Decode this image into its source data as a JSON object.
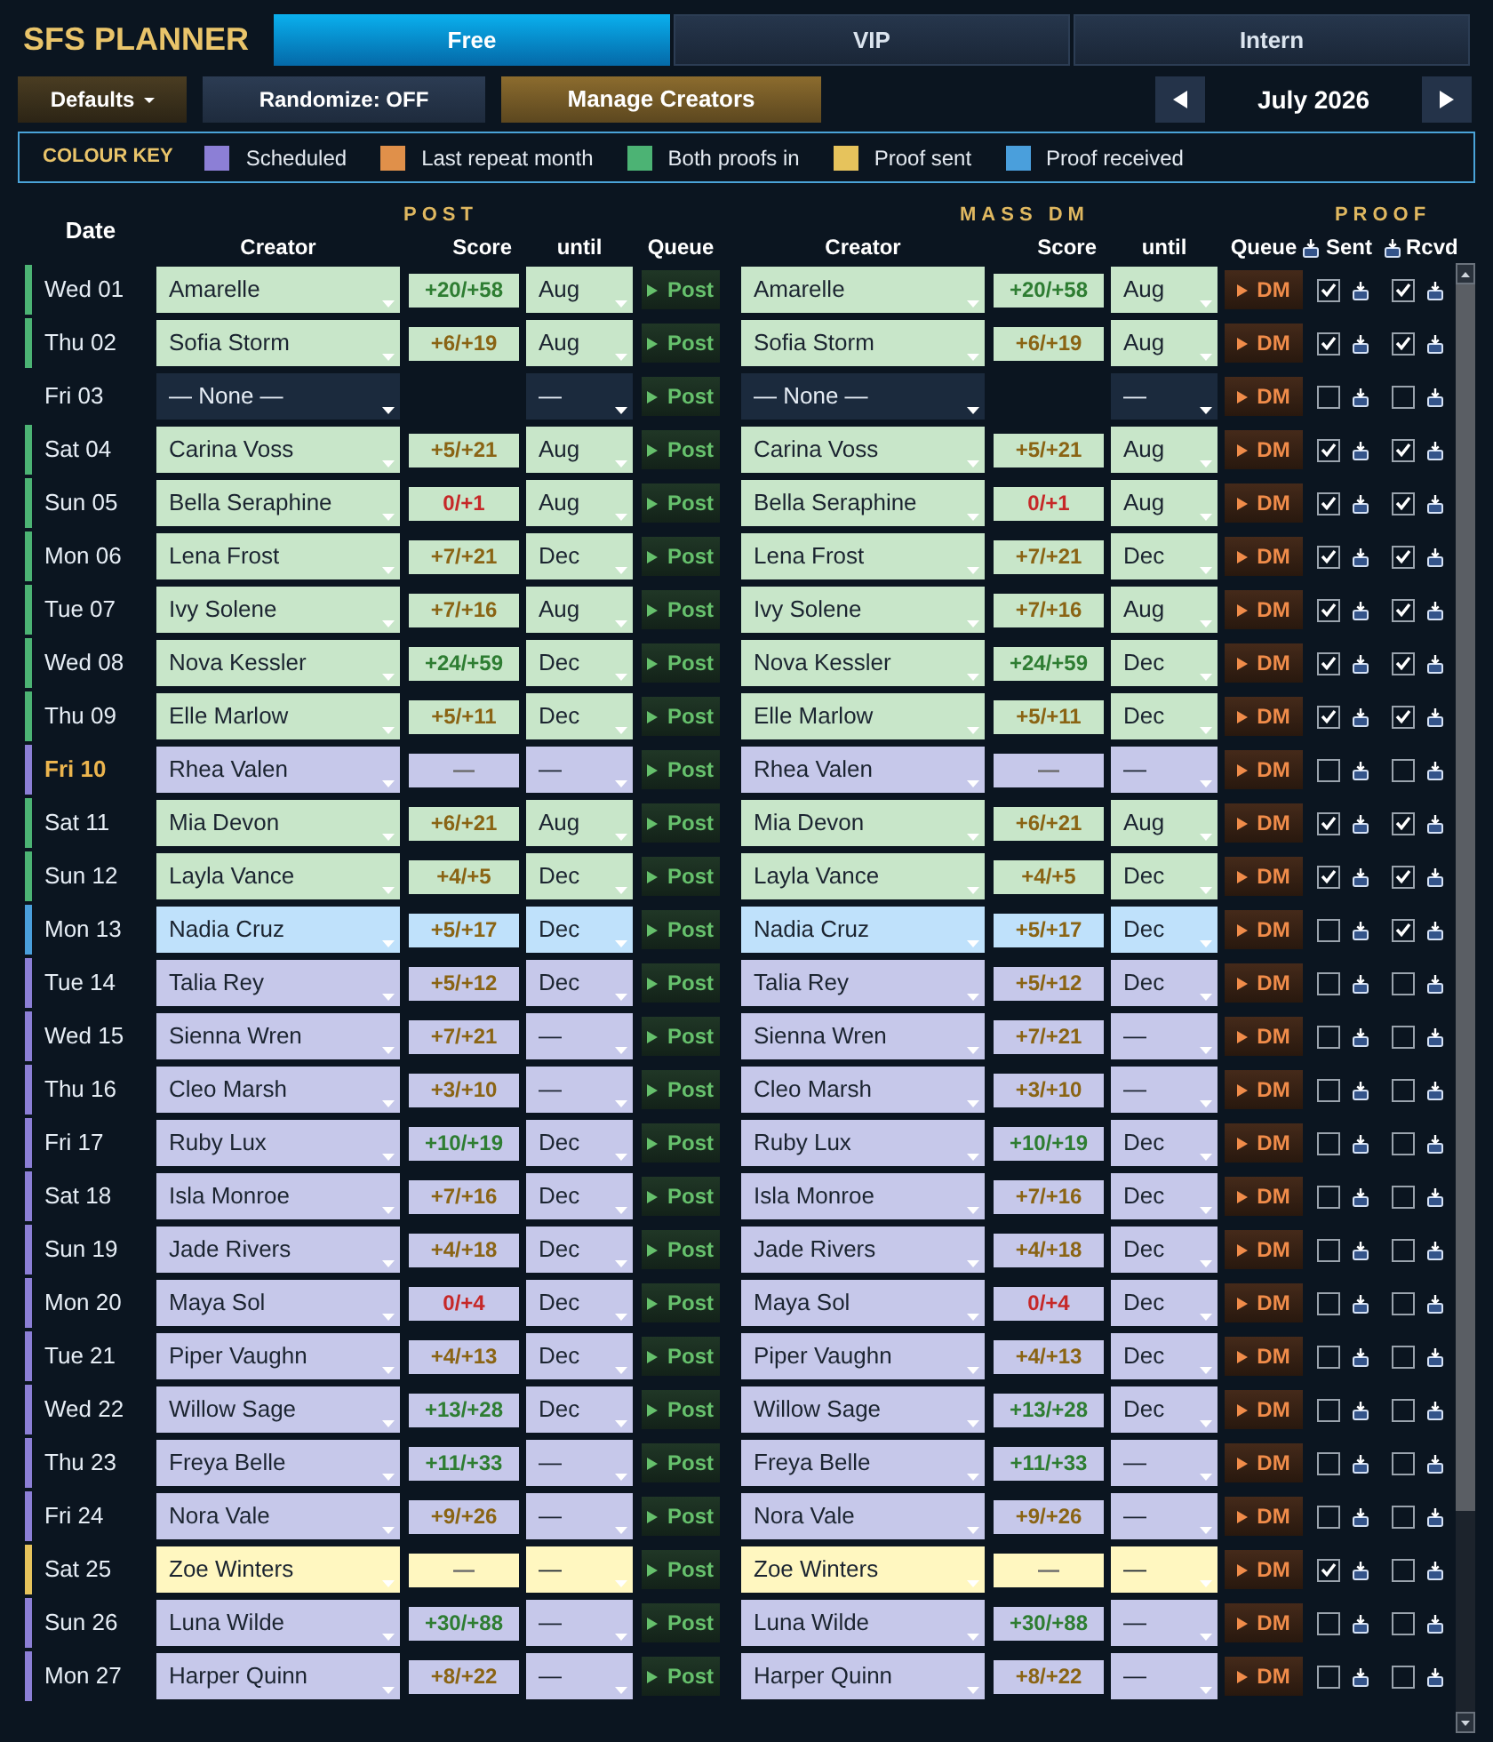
{
  "app": {
    "title": "SFS PLANNER"
  },
  "tabs": [
    {
      "label": "Free",
      "selected": true
    },
    {
      "label": "VIP",
      "selected": false
    },
    {
      "label": "Intern",
      "selected": false
    }
  ],
  "toolbar": {
    "defaults_button": "Defaults",
    "randomize_button": "Randomize: OFF",
    "manage_button": "Manage Creators",
    "month": "July 2026"
  },
  "colour_key": {
    "title": "COLOUR KEY",
    "items": [
      {
        "label": "Scheduled",
        "color": "#8c7fd6"
      },
      {
        "label": "Last repeat month",
        "color": "#e0904a"
      },
      {
        "label": "Both proofs in",
        "color": "#4cb374"
      },
      {
        "label": "Proof sent",
        "color": "#e6c35c"
      },
      {
        "label": "Proof received",
        "color": "#4a9fdc"
      }
    ]
  },
  "table": {
    "columns": {
      "date": "Date",
      "post": {
        "label": "POST",
        "creator": "Creator",
        "score": "Score",
        "until": "until",
        "queue": "Queue"
      },
      "mass_dm": {
        "label": "MASS DM",
        "creator": "Creator",
        "score": "Score",
        "until": "until",
        "queue": "Queue"
      },
      "proof": {
        "label": "PROOF",
        "sent": "Sent",
        "received": "Rcvd"
      }
    },
    "rows": [
      {
        "date": "Wed 01",
        "highlighted": false,
        "color": "#4cb374",
        "post": {
          "creator": "Amarelle",
          "score": {
            "value": "+20/+58",
            "color": "#2e7d32"
          },
          "until": "Aug",
          "queue_button": "Post"
        },
        "mass_dm": {
          "creator": "Amarelle",
          "score": {
            "value": "+20/+58",
            "color": "#2e7d32"
          },
          "until": "Aug",
          "queue_button": "DM"
        },
        "proof_sent": true,
        "proof_received": true
      },
      {
        "date": "Thu 02",
        "highlighted": false,
        "color": "#4cb374",
        "post": {
          "creator": "Sofia Storm",
          "score": {
            "value": "+6/+19",
            "color": "#8a6414"
          },
          "until": "Aug",
          "queue_button": "Post"
        },
        "mass_dm": {
          "creator": "Sofia Storm",
          "score": {
            "value": "+6/+19",
            "color": "#8a6414"
          },
          "until": "Aug",
          "queue_button": "DM"
        },
        "proof_sent": true,
        "proof_received": true
      },
      {
        "date": "Fri 03",
        "highlighted": false,
        "post": {
          "creator": "— None —",
          "until": "—",
          "queue_button": "Post"
        },
        "mass_dm": {
          "creator": "— None —",
          "until": "—",
          "queue_button": "DM"
        },
        "proof_sent": false,
        "proof_received": false
      },
      {
        "date": "Sat 04",
        "highlighted": false,
        "color": "#4cb374",
        "post": {
          "creator": "Carina Voss",
          "score": {
            "value": "+5/+21",
            "color": "#8a6414"
          },
          "until": "Aug",
          "queue_button": "Post"
        },
        "mass_dm": {
          "creator": "Carina Voss",
          "score": {
            "value": "+5/+21",
            "color": "#8a6414"
          },
          "until": "Aug",
          "queue_button": "DM"
        },
        "proof_sent": true,
        "proof_received": true
      },
      {
        "date": "Sun 05",
        "highlighted": false,
        "color": "#4cb374",
        "post": {
          "creator": "Bella Seraphine",
          "score": {
            "value": "0/+1",
            "color": "#c62828"
          },
          "until": "Aug",
          "queue_button": "Post"
        },
        "mass_dm": {
          "creator": "Bella Seraphine",
          "score": {
            "value": "0/+1",
            "color": "#c62828"
          },
          "until": "Aug",
          "queue_button": "DM"
        },
        "proof_sent": true,
        "proof_received": true
      },
      {
        "date": "Mon 06",
        "highlighted": false,
        "color": "#4cb374",
        "post": {
          "creator": "Lena Frost",
          "score": {
            "value": "+7/+21",
            "color": "#8a6414"
          },
          "until": "Dec",
          "queue_button": "Post"
        },
        "mass_dm": {
          "creator": "Lena Frost",
          "score": {
            "value": "+7/+21",
            "color": "#8a6414"
          },
          "until": "Dec",
          "queue_button": "DM"
        },
        "proof_sent": true,
        "proof_received": true
      },
      {
        "date": "Tue 07",
        "highlighted": false,
        "color": "#4cb374",
        "post": {
          "creator": "Ivy Solene",
          "score": {
            "value": "+7/+16",
            "color": "#8a6414"
          },
          "until": "Aug",
          "queue_button": "Post"
        },
        "mass_dm": {
          "creator": "Ivy Solene",
          "score": {
            "value": "+7/+16",
            "color": "#8a6414"
          },
          "until": "Aug",
          "queue_button": "DM"
        },
        "proof_sent": true,
        "proof_received": true
      },
      {
        "date": "Wed 08",
        "highlighted": false,
        "color": "#4cb374",
        "post": {
          "creator": "Nova Kessler",
          "score": {
            "value": "+24/+59",
            "color": "#2e7d32"
          },
          "until": "Dec",
          "queue_button": "Post"
        },
        "mass_dm": {
          "creator": "Nova Kessler",
          "score": {
            "value": "+24/+59",
            "color": "#2e7d32"
          },
          "until": "Dec",
          "queue_button": "DM"
        },
        "proof_sent": true,
        "proof_received": true
      },
      {
        "date": "Thu 09",
        "highlighted": false,
        "color": "#4cb374",
        "post": {
          "creator": "Elle Marlow",
          "score": {
            "value": "+5/+11",
            "color": "#8a6414"
          },
          "until": "Dec",
          "queue_button": "Post"
        },
        "mass_dm": {
          "creator": "Elle Marlow",
          "score": {
            "value": "+5/+11",
            "color": "#8a6414"
          },
          "until": "Dec",
          "queue_button": "DM"
        },
        "proof_sent": true,
        "proof_received": true
      },
      {
        "date": "Fri 10",
        "highlighted": true,
        "color": "#8c7fd6",
        "post": {
          "creator": "Rhea Valen",
          "score": {
            "value": "—",
            "color": "#6b6b6b"
          },
          "until": "—",
          "queue_button": "Post"
        },
        "mass_dm": {
          "creator": "Rhea Valen",
          "score": {
            "value": "—",
            "color": "#6b6b6b"
          },
          "until": "—",
          "queue_button": "DM"
        },
        "proof_sent": false,
        "proof_received": false
      },
      {
        "date": "Sat 11",
        "highlighted": false,
        "color": "#4cb374",
        "post": {
          "creator": "Mia Devon",
          "score": {
            "value": "+6/+21",
            "color": "#8a6414"
          },
          "until": "Aug",
          "queue_button": "Post"
        },
        "mass_dm": {
          "creator": "Mia Devon",
          "score": {
            "value": "+6/+21",
            "color": "#8a6414"
          },
          "until": "Aug",
          "queue_button": "DM"
        },
        "proof_sent": true,
        "proof_received": true
      },
      {
        "date": "Sun 12",
        "highlighted": false,
        "color": "#4cb374",
        "post": {
          "creator": "Layla Vance",
          "score": {
            "value": "+4/+5",
            "color": "#8a6414"
          },
          "until": "Dec",
          "queue_button": "Post"
        },
        "mass_dm": {
          "creator": "Layla Vance",
          "score": {
            "value": "+4/+5",
            "color": "#8a6414"
          },
          "until": "Dec",
          "queue_button": "DM"
        },
        "proof_sent": true,
        "proof_received": true
      },
      {
        "date": "Mon 13",
        "highlighted": false,
        "color": "#4a9fdc",
        "post": {
          "creator": "Nadia Cruz",
          "score": {
            "value": "+5/+17",
            "color": "#8a6414"
          },
          "until": "Dec",
          "queue_button": "Post"
        },
        "mass_dm": {
          "creator": "Nadia Cruz",
          "score": {
            "value": "+5/+17",
            "color": "#8a6414"
          },
          "until": "Dec",
          "queue_button": "DM"
        },
        "proof_sent": false,
        "proof_received": true
      },
      {
        "date": "Tue 14",
        "highlighted": false,
        "color": "#8c7fd6",
        "post": {
          "creator": "Talia Rey",
          "score": {
            "value": "+5/+12",
            "color": "#8a6414"
          },
          "until": "Dec",
          "queue_button": "Post"
        },
        "mass_dm": {
          "creator": "Talia Rey",
          "score": {
            "value": "+5/+12",
            "color": "#8a6414"
          },
          "until": "Dec",
          "queue_button": "DM"
        },
        "proof_sent": false,
        "proof_received": false
      },
      {
        "date": "Wed 15",
        "highlighted": false,
        "color": "#8c7fd6",
        "post": {
          "creator": "Sienna Wren",
          "score": {
            "value": "+7/+21",
            "color": "#8a6414"
          },
          "until": "—",
          "queue_button": "Post"
        },
        "mass_dm": {
          "creator": "Sienna Wren",
          "score": {
            "value": "+7/+21",
            "color": "#8a6414"
          },
          "until": "—",
          "queue_button": "DM"
        },
        "proof_sent": false,
        "proof_received": false
      },
      {
        "date": "Thu 16",
        "highlighted": false,
        "color": "#8c7fd6",
        "post": {
          "creator": "Cleo Marsh",
          "score": {
            "value": "+3/+10",
            "color": "#8a6414"
          },
          "until": "—",
          "queue_button": "Post"
        },
        "mass_dm": {
          "creator": "Cleo Marsh",
          "score": {
            "value": "+3/+10",
            "color": "#8a6414"
          },
          "until": "—",
          "queue_button": "DM"
        },
        "proof_sent": false,
        "proof_received": false
      },
      {
        "date": "Fri 17",
        "highlighted": false,
        "color": "#8c7fd6",
        "post": {
          "creator": "Ruby Lux",
          "score": {
            "value": "+10/+19",
            "color": "#2e7d32"
          },
          "until": "Dec",
          "queue_button": "Post"
        },
        "mass_dm": {
          "creator": "Ruby Lux",
          "score": {
            "value": "+10/+19",
            "color": "#2e7d32"
          },
          "until": "Dec",
          "queue_button": "DM"
        },
        "proof_sent": false,
        "proof_received": false
      },
      {
        "date": "Sat 18",
        "highlighted": false,
        "color": "#8c7fd6",
        "post": {
          "creator": "Isla Monroe",
          "score": {
            "value": "+7/+16",
            "color": "#8a6414"
          },
          "until": "Dec",
          "queue_button": "Post"
        },
        "mass_dm": {
          "creator": "Isla Monroe",
          "score": {
            "value": "+7/+16",
            "color": "#8a6414"
          },
          "until": "Dec",
          "queue_button": "DM"
        },
        "proof_sent": false,
        "proof_received": false
      },
      {
        "date": "Sun 19",
        "highlighted": false,
        "color": "#8c7fd6",
        "post": {
          "creator": "Jade Rivers",
          "score": {
            "value": "+4/+18",
            "color": "#8a6414"
          },
          "until": "Dec",
          "queue_button": "Post"
        },
        "mass_dm": {
          "creator": "Jade Rivers",
          "score": {
            "value": "+4/+18",
            "color": "#8a6414"
          },
          "until": "Dec",
          "queue_button": "DM"
        },
        "proof_sent": false,
        "proof_received": false
      },
      {
        "date": "Mon 20",
        "highlighted": false,
        "color": "#8c7fd6",
        "post": {
          "creator": "Maya Sol",
          "score": {
            "value": "0/+4",
            "color": "#c62828"
          },
          "until": "Dec",
          "queue_button": "Post"
        },
        "mass_dm": {
          "creator": "Maya Sol",
          "score": {
            "value": "0/+4",
            "color": "#c62828"
          },
          "until": "Dec",
          "queue_button": "DM"
        },
        "proof_sent": false,
        "proof_received": false
      },
      {
        "date": "Tue 21",
        "highlighted": false,
        "color": "#8c7fd6",
        "post": {
          "creator": "Piper Vaughn",
          "score": {
            "value": "+4/+13",
            "color": "#8a6414"
          },
          "until": "Dec",
          "queue_button": "Post"
        },
        "mass_dm": {
          "creator": "Piper Vaughn",
          "score": {
            "value": "+4/+13",
            "color": "#8a6414"
          },
          "until": "Dec",
          "queue_button": "DM"
        },
        "proof_sent": false,
        "proof_received": false
      },
      {
        "date": "Wed 22",
        "highlighted": false,
        "color": "#8c7fd6",
        "post": {
          "creator": "Willow Sage",
          "score": {
            "value": "+13/+28",
            "color": "#2e7d32"
          },
          "until": "Dec",
          "queue_button": "Post"
        },
        "mass_dm": {
          "creator": "Willow Sage",
          "score": {
            "value": "+13/+28",
            "color": "#2e7d32"
          },
          "until": "Dec",
          "queue_button": "DM"
        },
        "proof_sent": false,
        "proof_received": false
      },
      {
        "date": "Thu 23",
        "highlighted": false,
        "color": "#8c7fd6",
        "post": {
          "creator": "Freya Belle",
          "score": {
            "value": "+11/+33",
            "color": "#2e7d32"
          },
          "until": "—",
          "queue_button": "Post"
        },
        "mass_dm": {
          "creator": "Freya Belle",
          "score": {
            "value": "+11/+33",
            "color": "#2e7d32"
          },
          "until": "—",
          "queue_button": "DM"
        },
        "proof_sent": false,
        "proof_received": false
      },
      {
        "date": "Fri 24",
        "highlighted": false,
        "color": "#8c7fd6",
        "post": {
          "creator": "Nora Vale",
          "score": {
            "value": "+9/+26",
            "color": "#8a6414"
          },
          "until": "—",
          "queue_button": "Post"
        },
        "mass_dm": {
          "creator": "Nora Vale",
          "score": {
            "value": "+9/+26",
            "color": "#8a6414"
          },
          "until": "—",
          "queue_button": "DM"
        },
        "proof_sent": false,
        "proof_received": false
      },
      {
        "date": "Sat 25",
        "highlighted": false,
        "color": "#e6c35c",
        "post": {
          "creator": "Zoe Winters",
          "score": {
            "value": "—",
            "color": "#6b6b6b"
          },
          "until": "—",
          "queue_button": "Post"
        },
        "mass_dm": {
          "creator": "Zoe Winters",
          "score": {
            "value": "—",
            "color": "#6b6b6b"
          },
          "until": "—",
          "queue_button": "DM"
        },
        "proof_sent": true,
        "proof_received": false
      },
      {
        "date": "Sun 26",
        "highlighted": false,
        "color": "#8c7fd6",
        "post": {
          "creator": "Luna Wilde",
          "score": {
            "value": "+30/+88",
            "color": "#2e7d32"
          },
          "until": "—",
          "queue_button": "Post"
        },
        "mass_dm": {
          "creator": "Luna Wilde",
          "score": {
            "value": "+30/+88",
            "color": "#2e7d32"
          },
          "until": "—",
          "queue_button": "DM"
        },
        "proof_sent": false,
        "proof_received": false
      },
      {
        "date": "Mon 27",
        "highlighted": false,
        "color": "#8c7fd6",
        "post": {
          "creator": "Harper Quinn",
          "score": {
            "value": "+8/+22",
            "color": "#8a6414"
          },
          "until": "—",
          "queue_button": "Post"
        },
        "mass_dm": {
          "creator": "Harper Quinn",
          "score": {
            "value": "+8/+22",
            "color": "#8a6414"
          },
          "until": "—",
          "queue_button": "DM"
        },
        "proof_sent": false,
        "proof_received": false
      }
    ]
  }
}
